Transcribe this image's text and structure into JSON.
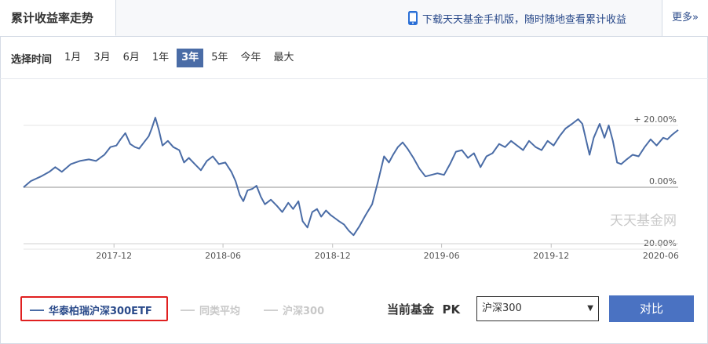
{
  "header": {
    "title": "累计收益率走势",
    "download_text": "下载天天基金手机版，随时随地查看累计收益",
    "more_label": "更多»"
  },
  "period_selector": {
    "label": "选择时间",
    "options": [
      "1月",
      "3月",
      "6月",
      "1年",
      "3年",
      "5年",
      "今年",
      "最大"
    ],
    "active": "3年"
  },
  "watermark": "天天基金网",
  "legend": {
    "items": [
      {
        "name": "华泰柏瑞沪深300ETF",
        "color": "#4a6ca6",
        "active": true
      },
      {
        "name": "同类平均",
        "color": "#d0d0d0",
        "active": false
      },
      {
        "name": "沪深300",
        "color": "#d0d0d0",
        "active": false
      }
    ]
  },
  "compare": {
    "label": "当前基金  PK",
    "selected": "沪深300",
    "button_label": "对比"
  },
  "colors": {
    "accent": "#4a6ca6",
    "button": "#4a72c2",
    "highlight_border": "#e02020"
  },
  "chart_data": {
    "type": "line",
    "x_ticks": [
      "2017-12",
      "2018-06",
      "2018-12",
      "2019-06",
      "2019-12",
      "2020-06"
    ],
    "y_ticks": [
      "20.00%",
      "0.00%",
      "-20.00%"
    ],
    "y_tick_prefix": [
      "+ ",
      "",
      ""
    ],
    "ylim": [
      -20,
      20
    ],
    "series": [
      {
        "name": "华泰柏瑞沪深300ETF",
        "points": [
          [
            "2017-07-03",
            0.0
          ],
          [
            "2017-07-15",
            2.0
          ],
          [
            "2017-08-01",
            3.5
          ],
          [
            "2017-08-15",
            5.0
          ],
          [
            "2017-08-25",
            6.5
          ],
          [
            "2017-09-05",
            5.0
          ],
          [
            "2017-09-20",
            7.5
          ],
          [
            "2017-10-05",
            8.5
          ],
          [
            "2017-10-20",
            9.0
          ],
          [
            "2017-11-01",
            8.5
          ],
          [
            "2017-11-15",
            10.5
          ],
          [
            "2017-11-25",
            13.0
          ],
          [
            "2017-12-05",
            13.5
          ],
          [
            "2017-12-12",
            15.5
          ],
          [
            "2017-12-20",
            17.5
          ],
          [
            "2017-12-28",
            14.0
          ],
          [
            "2018-01-05",
            13.0
          ],
          [
            "2018-01-12",
            12.5
          ],
          [
            "2018-01-20",
            14.5
          ],
          [
            "2018-01-28",
            16.5
          ],
          [
            "2018-02-02",
            19.0
          ],
          [
            "2018-02-08",
            22.5
          ],
          [
            "2018-02-14",
            18.5
          ],
          [
            "2018-02-20",
            13.5
          ],
          [
            "2018-03-01",
            15.0
          ],
          [
            "2018-03-10",
            13.0
          ],
          [
            "2018-03-20",
            12.0
          ],
          [
            "2018-03-28",
            8.0
          ],
          [
            "2018-04-05",
            9.5
          ],
          [
            "2018-04-15",
            7.5
          ],
          [
            "2018-04-25",
            5.5
          ],
          [
            "2018-05-05",
            8.5
          ],
          [
            "2018-05-15",
            10.0
          ],
          [
            "2018-05-25",
            7.5
          ],
          [
            "2018-06-05",
            8.0
          ],
          [
            "2018-06-15",
            5.0
          ],
          [
            "2018-06-22",
            2.0
          ],
          [
            "2018-06-29",
            -2.5
          ],
          [
            "2018-07-05",
            -4.5
          ],
          [
            "2018-07-12",
            -1.0
          ],
          [
            "2018-07-20",
            -0.5
          ],
          [
            "2018-07-27",
            0.5
          ],
          [
            "2018-08-03",
            -3.0
          ],
          [
            "2018-08-10",
            -5.5
          ],
          [
            "2018-08-20",
            -4.0
          ],
          [
            "2018-08-30",
            -6.0
          ],
          [
            "2018-09-08",
            -8.0
          ],
          [
            "2018-09-18",
            -5.0
          ],
          [
            "2018-09-26",
            -7.0
          ],
          [
            "2018-10-05",
            -4.5
          ],
          [
            "2018-10-12",
            -11.0
          ],
          [
            "2018-10-20",
            -13.0
          ],
          [
            "2018-10-28",
            -8.0
          ],
          [
            "2018-11-05",
            -7.0
          ],
          [
            "2018-11-12",
            -9.5
          ],
          [
            "2018-11-20",
            -7.5
          ],
          [
            "2018-11-28",
            -9.0
          ],
          [
            "2018-12-05",
            -10.0
          ],
          [
            "2018-12-12",
            -11.0
          ],
          [
            "2018-12-20",
            -12.0
          ],
          [
            "2018-12-28",
            -14.0
          ],
          [
            "2019-01-05",
            -15.5
          ],
          [
            "2019-01-15",
            -12.5
          ],
          [
            "2019-01-25",
            -9.0
          ],
          [
            "2019-02-05",
            -5.5
          ],
          [
            "2019-02-15",
            2.0
          ],
          [
            "2019-02-25",
            10.0
          ],
          [
            "2019-03-05",
            8.0
          ],
          [
            "2019-03-12",
            10.5
          ],
          [
            "2019-03-20",
            13.0
          ],
          [
            "2019-03-28",
            14.5
          ],
          [
            "2019-04-05",
            12.5
          ],
          [
            "2019-04-15",
            9.5
          ],
          [
            "2019-04-25",
            6.0
          ],
          [
            "2019-05-05",
            3.5
          ],
          [
            "2019-05-15",
            4.0
          ],
          [
            "2019-05-25",
            4.5
          ],
          [
            "2019-06-05",
            4.0
          ],
          [
            "2019-06-15",
            7.5
          ],
          [
            "2019-06-25",
            11.5
          ],
          [
            "2019-07-05",
            12.0
          ],
          [
            "2019-07-15",
            9.5
          ],
          [
            "2019-07-25",
            11.0
          ],
          [
            "2019-08-05",
            6.5
          ],
          [
            "2019-08-15",
            10.0
          ],
          [
            "2019-08-25",
            11.0
          ],
          [
            "2019-09-05",
            14.0
          ],
          [
            "2019-09-15",
            13.0
          ],
          [
            "2019-09-25",
            15.0
          ],
          [
            "2019-10-05",
            13.5
          ],
          [
            "2019-10-15",
            12.0
          ],
          [
            "2019-10-25",
            15.0
          ],
          [
            "2019-11-05",
            13.0
          ],
          [
            "2019-11-15",
            12.0
          ],
          [
            "2019-11-25",
            15.0
          ],
          [
            "2019-12-05",
            13.5
          ],
          [
            "2019-12-15",
            16.5
          ],
          [
            "2019-12-25",
            19.0
          ],
          [
            "2020-01-05",
            20.5
          ],
          [
            "2020-01-15",
            22.0
          ],
          [
            "2020-01-22",
            20.5
          ],
          [
            "2020-02-03",
            10.5
          ],
          [
            "2020-02-10",
            16.0
          ],
          [
            "2020-02-20",
            20.5
          ],
          [
            "2020-02-28",
            16.0
          ],
          [
            "2020-03-06",
            20.0
          ],
          [
            "2020-03-13",
            15.0
          ],
          [
            "2020-03-20",
            8.0
          ],
          [
            "2020-03-27",
            7.5
          ],
          [
            "2020-04-05",
            9.0
          ],
          [
            "2020-04-15",
            10.5
          ],
          [
            "2020-04-25",
            10.0
          ],
          [
            "2020-05-05",
            13.0
          ],
          [
            "2020-05-15",
            15.5
          ],
          [
            "2020-05-25",
            13.5
          ],
          [
            "2020-06-05",
            16.0
          ],
          [
            "2020-06-12",
            15.5
          ],
          [
            "2020-06-20",
            17.0
          ],
          [
            "2020-06-30",
            18.5
          ]
        ]
      }
    ]
  }
}
